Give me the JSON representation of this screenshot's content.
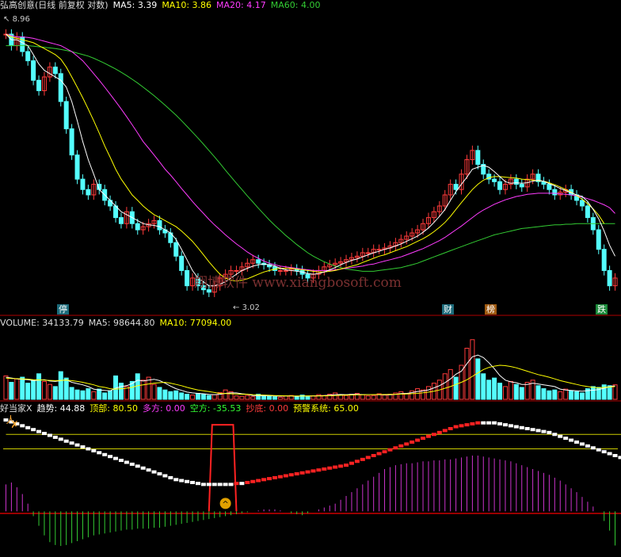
{
  "colors": {
    "bg": "#000000",
    "up": "#ff3b3b",
    "down": "#54ffff",
    "ma5": "#ffffff",
    "ma10": "#ffff00",
    "ma20": "#ff3cff",
    "ma60": "#33cc33",
    "border": "#b00000"
  },
  "price_panel": {
    "title": "弘高创意(日线 前复权 对数)",
    "ma5_label": "MA5:",
    "ma5": "3.39",
    "ma10_label": "MA10:",
    "ma10": "3.86",
    "ma20_label": "MA20:",
    "ma20": "4.17",
    "ma60_label": "MA60:",
    "ma60": "4.00",
    "high_mark": "8.96",
    "low_mark": "3.02",
    "markers": [
      "停",
      "财",
      "榜",
      "跌"
    ],
    "watermark": "翔博软件 www.xiangbosoft.com"
  },
  "volume_panel": {
    "volume_label": "VOLUME:",
    "volume": "34133.79",
    "ma5_label": "MA5:",
    "ma5": "98644.80",
    "ma10_label": "MA10:",
    "ma10": "77094.00"
  },
  "indicator_panel": {
    "name": "好当家X",
    "trend_label": "趋势:",
    "trend": "44.88",
    "top_label": "顶部:",
    "top": "80.50",
    "bull_label": "多方:",
    "bull": "0.00",
    "bear_label": "空方:",
    "bear": "-35.53",
    "bottom_label": "抄底:",
    "bottom": "0.00",
    "warn_label": "预警系统:",
    "warn": "65.00"
  },
  "chart_data": {
    "type": "line",
    "days": 112,
    "price": {
      "scale": "log",
      "ylim": [
        2.8,
        9.5
      ],
      "close": [
        8.7,
        8.3,
        8.6,
        8.1,
        7.8,
        7.2,
        6.9,
        7.3,
        7.6,
        7.4,
        6.6,
        5.9,
        5.3,
        4.8,
        4.6,
        4.5,
        4.7,
        4.6,
        4.4,
        4.3,
        4.1,
        4.0,
        4.2,
        4.0,
        3.9,
        3.95,
        4.0,
        4.05,
        3.9,
        3.85,
        3.7,
        3.5,
        3.3,
        3.1,
        3.2,
        3.1,
        3.05,
        3.02,
        3.1,
        3.2,
        3.25,
        3.3,
        3.3,
        3.35,
        3.4,
        3.45,
        3.4,
        3.38,
        3.35,
        3.3,
        3.3,
        3.3,
        3.32,
        3.3,
        3.25,
        3.2,
        3.25,
        3.3,
        3.35,
        3.38,
        3.4,
        3.42,
        3.45,
        3.48,
        3.5,
        3.55,
        3.55,
        3.6,
        3.6,
        3.62,
        3.65,
        3.7,
        3.75,
        3.8,
        3.85,
        3.9,
        4.0,
        4.1,
        4.2,
        4.3,
        4.5,
        4.7,
        4.6,
        4.9,
        5.2,
        5.4,
        5.1,
        4.9,
        4.8,
        4.75,
        4.6,
        4.7,
        4.8,
        4.7,
        4.65,
        4.8,
        4.9,
        4.75,
        4.7,
        4.6,
        4.5,
        4.55,
        4.6,
        4.5,
        4.4,
        4.3,
        4.1,
        3.9,
        3.6,
        3.3,
        3.1,
        3.2
      ],
      "ma5": [
        8.7,
        8.5,
        8.5,
        8.4,
        8.3,
        8.0,
        7.7,
        7.5,
        7.4,
        7.3,
        7.2,
        7.0,
        6.6,
        6.1,
        5.6,
        5.2,
        4.9,
        4.6,
        4.5,
        4.4,
        4.3,
        4.2,
        4.15,
        4.1,
        4.05,
        4.0,
        3.98,
        3.97,
        3.95,
        3.9,
        3.85,
        3.75,
        3.6,
        3.45,
        3.3,
        3.2,
        3.15,
        3.1,
        3.1,
        3.12,
        3.15,
        3.2,
        3.25,
        3.3,
        3.33,
        3.36,
        3.38,
        3.39,
        3.38,
        3.36,
        3.33,
        3.31,
        3.3,
        3.29,
        3.28,
        3.26,
        3.25,
        3.26,
        3.28,
        3.31,
        3.34,
        3.38,
        3.41,
        3.44,
        3.46,
        3.49,
        3.52,
        3.55,
        3.57,
        3.6,
        3.62,
        3.65,
        3.68,
        3.72,
        3.76,
        3.8,
        3.86,
        3.93,
        4.02,
        4.12,
        4.24,
        4.4,
        4.56,
        4.7,
        4.84,
        5.0,
        5.04,
        5.08,
        5.04,
        4.95,
        4.85,
        4.75,
        4.72,
        4.73,
        4.72,
        4.73,
        4.76,
        4.78,
        4.76,
        4.71,
        4.67,
        4.62,
        4.58,
        4.54,
        4.5,
        4.47,
        4.38,
        4.24,
        4.08,
        3.88,
        3.66,
        3.5
      ],
      "ma10": [
        8.7,
        8.6,
        8.55,
        8.5,
        8.45,
        8.4,
        8.3,
        8.2,
        8.1,
        8.0,
        7.85,
        7.6,
        7.3,
        7.0,
        6.7,
        6.4,
        6.1,
        5.8,
        5.5,
        5.25,
        5.0,
        4.8,
        4.65,
        4.5,
        4.4,
        4.3,
        4.22,
        4.15,
        4.1,
        4.05,
        4.0,
        3.95,
        3.88,
        3.8,
        3.72,
        3.62,
        3.52,
        3.42,
        3.33,
        3.25,
        3.2,
        3.17,
        3.16,
        3.17,
        3.19,
        3.22,
        3.25,
        3.28,
        3.3,
        3.32,
        3.33,
        3.33,
        3.33,
        3.32,
        3.31,
        3.3,
        3.29,
        3.28,
        3.28,
        3.29,
        3.3,
        3.32,
        3.34,
        3.36,
        3.38,
        3.41,
        3.44,
        3.47,
        3.5,
        3.52,
        3.55,
        3.58,
        3.61,
        3.64,
        3.68,
        3.72,
        3.76,
        3.81,
        3.87,
        3.94,
        4.02,
        4.12,
        4.24,
        4.36,
        4.48,
        4.6,
        4.7,
        4.78,
        4.83,
        4.85,
        4.85,
        4.84,
        4.83,
        4.82,
        4.8,
        4.79,
        4.78,
        4.77,
        4.76,
        4.73,
        4.69,
        4.65,
        4.6,
        4.55,
        4.49,
        4.42,
        4.34,
        4.25,
        4.14,
        4.0
      ],
      "ma20": [
        8.7,
        8.65,
        8.6,
        8.6,
        8.58,
        8.55,
        8.5,
        8.45,
        8.4,
        8.35,
        8.3,
        8.2,
        8.1,
        7.95,
        7.8,
        7.6,
        7.4,
        7.2,
        7.0,
        6.8,
        6.6,
        6.4,
        6.2,
        6.0,
        5.8,
        5.6,
        5.45,
        5.3,
        5.15,
        5.0,
        4.88,
        4.75,
        4.62,
        4.5,
        4.38,
        4.27,
        4.17,
        4.07,
        3.98,
        3.9,
        3.82,
        3.75,
        3.68,
        3.62,
        3.56,
        3.51,
        3.47,
        3.43,
        3.4,
        3.38,
        3.36,
        3.35,
        3.34,
        3.33,
        3.32,
        3.31,
        3.3,
        3.3,
        3.3,
        3.3,
        3.31,
        3.32,
        3.33,
        3.34,
        3.35,
        3.36,
        3.38,
        3.39,
        3.41,
        3.43,
        3.45,
        3.47,
        3.49,
        3.52,
        3.55,
        3.58,
        3.61,
        3.65,
        3.69,
        3.73,
        3.78,
        3.84,
        3.9,
        3.96,
        4.03,
        4.1,
        4.17,
        4.23,
        4.28,
        4.33,
        4.37,
        4.41,
        4.44,
        4.47,
        4.49,
        4.51,
        4.52,
        4.53,
        4.53,
        4.53,
        4.53,
        4.52,
        4.51,
        4.5,
        4.48,
        4.46,
        4.43,
        4.4,
        4.36,
        4.32,
        4.27,
        4.17
      ],
      "ma60": [
        8.3,
        8.3,
        8.3,
        8.3,
        8.3,
        8.28,
        8.26,
        8.24,
        8.22,
        8.2,
        8.17,
        8.14,
        8.1,
        8.05,
        8.0,
        7.95,
        7.88,
        7.8,
        7.72,
        7.63,
        7.54,
        7.44,
        7.34,
        7.23,
        7.12,
        7.0,
        6.88,
        6.76,
        6.63,
        6.5,
        6.37,
        6.24,
        6.1,
        5.96,
        5.82,
        5.68,
        5.54,
        5.4,
        5.26,
        5.12,
        4.98,
        4.85,
        4.72,
        4.6,
        4.48,
        4.37,
        4.26,
        4.16,
        4.06,
        3.97,
        3.89,
        3.81,
        3.74,
        3.67,
        3.61,
        3.55,
        3.5,
        3.46,
        3.42,
        3.39,
        3.36,
        3.34,
        3.32,
        3.31,
        3.3,
        3.29,
        3.29,
        3.29,
        3.3,
        3.31,
        3.32,
        3.33,
        3.34,
        3.36,
        3.38,
        3.4,
        3.43,
        3.46,
        3.49,
        3.52,
        3.55,
        3.58,
        3.61,
        3.64,
        3.67,
        3.7,
        3.73,
        3.76,
        3.79,
        3.82,
        3.84,
        3.86,
        3.88,
        3.9,
        3.92,
        3.93,
        3.94,
        3.95,
        3.96,
        3.97,
        3.98,
        3.98,
        3.99,
        3.99,
        4.0,
        4.0,
        4.0,
        4.0,
        4.0,
        4.0,
        4.0,
        4.0
      ]
    },
    "volume": {
      "ylim": [
        0,
        160000
      ],
      "values": [
        55000,
        40000,
        48000,
        52000,
        38000,
        45000,
        60000,
        42000,
        35000,
        30000,
        65000,
        50000,
        28000,
        22000,
        20000,
        25000,
        18000,
        24000,
        15000,
        20000,
        55000,
        38000,
        30000,
        42000,
        60000,
        45000,
        52000,
        35000,
        28000,
        22000,
        18000,
        20000,
        15000,
        12000,
        10000,
        14000,
        12000,
        9000,
        11000,
        16000,
        22000,
        18000,
        8000,
        7000,
        9000,
        6000,
        12000,
        8000,
        7000,
        6000,
        5000,
        8000,
        9000,
        7000,
        10000,
        6000,
        8000,
        11000,
        9000,
        12000,
        15000,
        10000,
        9000,
        12000,
        14000,
        11000,
        8000,
        9000,
        13000,
        10000,
        12000,
        15000,
        18000,
        14000,
        20000,
        25000,
        22000,
        30000,
        38000,
        45000,
        60000,
        70000,
        52000,
        80000,
        120000,
        140000,
        95000,
        60000,
        45000,
        50000,
        38000,
        30000,
        42000,
        35000,
        28000,
        40000,
        45000,
        32000,
        25000,
        20000,
        22000,
        18000,
        24000,
        20000,
        18000,
        15000,
        25000,
        30000,
        28000,
        34000,
        32000,
        34133
      ],
      "ma5": [
        52000,
        50000,
        48000,
        47000,
        46000,
        44000,
        45000,
        46000,
        43000,
        42000,
        44000,
        46000,
        40000,
        37000,
        34000,
        30000,
        24000,
        22000,
        21000,
        20000,
        26000,
        30000,
        32000,
        37000,
        45000,
        43000,
        45000,
        47000,
        44000,
        38000,
        31000,
        25000,
        21000,
        17000,
        15000,
        14000,
        13000,
        11500,
        11000,
        12000,
        14000,
        15000,
        15000,
        13000,
        12000,
        9000,
        8500,
        8500,
        8500,
        8000,
        7600,
        7800,
        7800,
        7000,
        7800,
        8000,
        8200,
        8400,
        8800,
        9800,
        11000,
        11400,
        11000,
        11600,
        12000,
        11200,
        11200,
        11000,
        11000,
        10600,
        10800,
        11800,
        13600,
        13800,
        15800,
        18400,
        19800,
        22200,
        27000,
        32000,
        39000,
        48000,
        59000,
        66000,
        84000,
        100000,
        104000,
        98000,
        86000,
        72000,
        56000,
        45000,
        41000,
        39000,
        35000,
        35000,
        38000,
        36000,
        34000,
        32000,
        30000,
        24000,
        22000,
        21000,
        20000,
        19000,
        20400,
        21400,
        23000,
        26000,
        30000,
        31700
      ],
      "ma10": [
        50000,
        49000,
        48500,
        48000,
        47500,
        46000,
        45500,
        45000,
        44500,
        44000,
        44500,
        45000,
        44000,
        42000,
        40000,
        37000,
        34000,
        30000,
        28000,
        25000,
        24000,
        25000,
        26000,
        28000,
        32000,
        34000,
        36000,
        38000,
        39000,
        40000,
        38000,
        35000,
        32000,
        28000,
        25000,
        22000,
        20000,
        18000,
        16000,
        14000,
        13500,
        13000,
        12500,
        12000,
        12000,
        11000,
        10500,
        10000,
        9500,
        9000,
        8500,
        8200,
        8000,
        7800,
        7800,
        7800,
        7800,
        8000,
        8200,
        8500,
        9000,
        9500,
        10000,
        10300,
        10600,
        10800,
        11000,
        11200,
        11400,
        11400,
        11600,
        11800,
        12200,
        12600,
        13200,
        14000,
        15400,
        17000,
        19200,
        22000,
        26000,
        30000,
        35000,
        40000,
        46000,
        54000,
        62000,
        70000,
        75000,
        78000,
        80000,
        79000,
        77000,
        74000,
        70000,
        66000,
        62000,
        58000,
        55000,
        52000,
        48000,
        44000,
        41000,
        38000,
        35000,
        32000,
        30000,
        28000,
        27000,
        28000,
        29000,
        30000
      ]
    },
    "indicator": {
      "ylim": [
        -45,
        100
      ],
      "trend": [
        95,
        93,
        91,
        89,
        87,
        85,
        83,
        81,
        79,
        77,
        75,
        73,
        71,
        69,
        67,
        65,
        63,
        61,
        59,
        57,
        55,
        53,
        51,
        49,
        47,
        45,
        43,
        41,
        39,
        37,
        35,
        33,
        32,
        31,
        30,
        29,
        28,
        28,
        28,
        28,
        28,
        28,
        29,
        29,
        30,
        31,
        32,
        33,
        34,
        35,
        36,
        37,
        38,
        39,
        40,
        41,
        42,
        43,
        44,
        45,
        46,
        47,
        48,
        50,
        52,
        54,
        56,
        58,
        60,
        62,
        64,
        66,
        68,
        70,
        72,
        74,
        76,
        78,
        80,
        82,
        84,
        86,
        88,
        89,
        90,
        91,
        92,
        92,
        92,
        92,
        91,
        90,
        89,
        88,
        87,
        86,
        85,
        84,
        83,
        82,
        80,
        78,
        76,
        74,
        72,
        70,
        68,
        66,
        64,
        62,
        60,
        58,
        56,
        54,
        50,
        44.88
      ],
      "bull_bear": [
        28,
        30,
        25,
        18,
        8,
        -5,
        -15,
        -25,
        -32,
        -35,
        -36,
        -35,
        -33,
        -31,
        -29,
        -27,
        -25,
        -24,
        -23,
        -22,
        -21,
        -20,
        -19,
        -19,
        -18,
        -18,
        -18,
        -17,
        -17,
        -16,
        -15,
        -14,
        -13,
        -12,
        -11,
        -10,
        -9,
        -8,
        -7,
        -6,
        -5,
        -4,
        -3,
        -2,
        -1,
        0,
        1,
        2,
        2,
        2,
        1,
        0,
        -2,
        -3,
        -4,
        -2,
        0,
        2,
        4,
        6,
        8,
        12,
        16,
        20,
        24,
        28,
        32,
        36,
        40,
        44,
        46,
        48,
        49,
        50,
        50,
        51,
        52,
        52,
        53,
        53,
        54,
        54,
        55,
        56,
        57,
        58,
        58,
        57,
        56,
        55,
        54,
        53,
        52,
        50,
        48,
        46,
        44,
        42,
        40,
        38,
        35,
        32,
        28,
        24,
        20,
        15,
        10,
        5,
        0,
        -10,
        -20,
        -35.53
      ],
      "top_band": [
        80,
        80,
        80,
        80,
        80,
        80,
        80,
        80,
        80,
        80,
        80,
        80,
        80,
        80,
        80,
        80,
        80,
        80,
        80,
        80,
        80,
        80,
        80,
        80,
        80,
        80,
        80,
        80,
        80,
        80,
        80,
        80,
        80,
        80,
        80,
        80,
        80,
        80,
        80,
        80,
        80,
        80,
        80,
        80,
        80,
        80,
        80,
        80,
        80,
        80,
        80,
        80,
        80,
        80,
        80,
        80,
        80,
        80,
        80,
        80,
        80,
        80,
        80,
        80,
        80,
        80,
        80,
        80,
        80,
        80,
        80,
        80,
        80,
        80,
        80,
        80,
        80,
        80,
        80,
        80,
        80,
        80,
        80,
        80,
        80,
        80,
        80,
        80,
        80,
        80,
        80,
        80,
        80,
        80,
        80,
        80,
        80,
        80,
        80,
        80,
        80,
        80,
        80,
        80,
        80,
        80,
        80,
        80,
        80,
        80,
        80,
        80,
        80,
        80,
        80,
        80.5
      ],
      "warn_line": 65,
      "spike_range": [
        37,
        42
      ]
    }
  }
}
